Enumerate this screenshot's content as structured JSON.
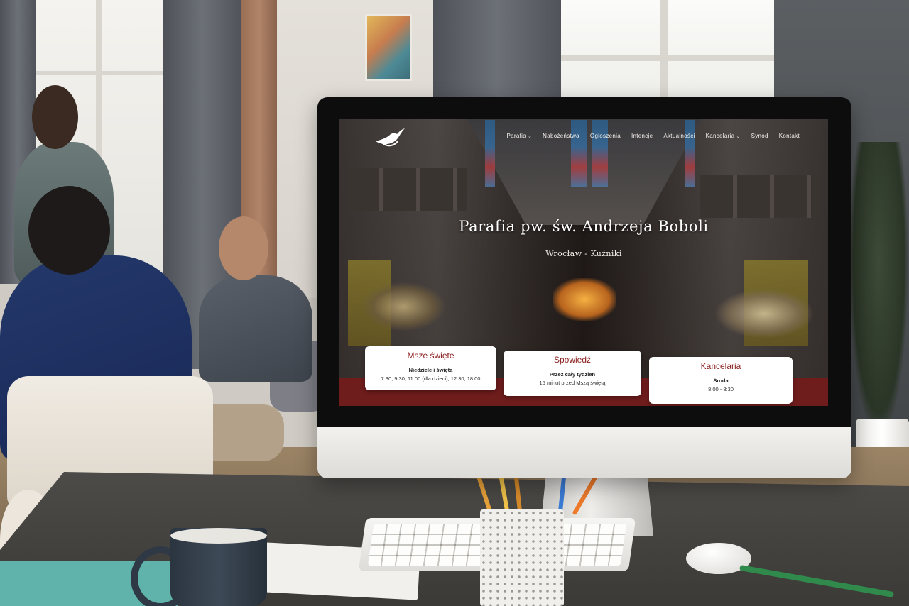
{
  "site": {
    "nav": [
      {
        "label": "Parafia",
        "dropdown": true
      },
      {
        "label": "Nabożeństwa",
        "dropdown": false
      },
      {
        "label": "Ogłoszenia",
        "dropdown": false
      },
      {
        "label": "Intencje",
        "dropdown": false
      },
      {
        "label": "Aktualności",
        "dropdown": false
      },
      {
        "label": "Kancelaria",
        "dropdown": true
      },
      {
        "label": "Synod",
        "dropdown": false
      },
      {
        "label": "Kontakt",
        "dropdown": false
      }
    ],
    "hero": {
      "title": "Parafia pw. św. Andrzeja Boboli",
      "subtitle": "Wrocław - Kuźniki"
    },
    "cards": [
      {
        "title": "Msze święte",
        "bold": "Niedziele i święta",
        "line": "7:30, 9:30, 11:00 (dla dzieci), 12:30, 18:00"
      },
      {
        "title": "Spowiedź",
        "bold": "Przez cały tydzień",
        "line": "15 minut przed Mszą świętą"
      },
      {
        "title": "Kancelaria",
        "bold": "Środa",
        "line": "8:00 - 8:30"
      }
    ]
  },
  "icons": {
    "logo": "dove-logo-icon",
    "dropdown": "chevron-down-icon"
  },
  "colors": {
    "accent": "#8b1e1e",
    "card_bg": "#ffffff",
    "nav_text": "#f3efe9"
  }
}
